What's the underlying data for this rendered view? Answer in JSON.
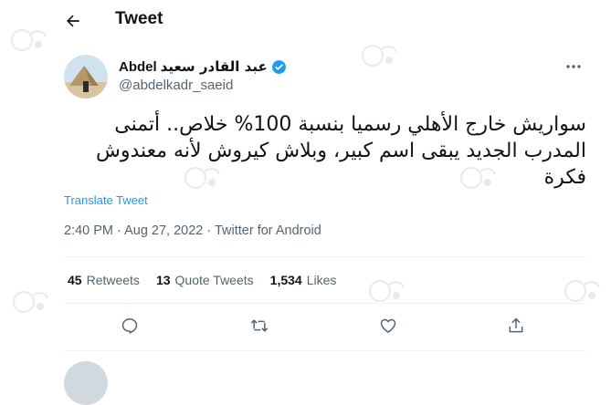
{
  "header": {
    "title": "Tweet"
  },
  "author": {
    "name_latin": "Abdel",
    "name_arabic": "عبد القادر سعيد",
    "handle": "@abdelkadr_saeid",
    "verified": true
  },
  "tweet": {
    "lines": [
      "سواريش خارج الأهلي رسميا بنسبة 100% خلاص.. أتمنى",
      "المدرب الجديد يبقى اسم كبير، وبلاش كيروش لأنه معندوش",
      "فكرة"
    ],
    "translate_label": "Translate Tweet",
    "meta": "2:40 PM · Aug 27, 2022 · Twitter for Android"
  },
  "stats": {
    "retweets": {
      "count": "45",
      "label": "Retweets"
    },
    "quotes": {
      "count": "13",
      "label": "Quote Tweets"
    },
    "likes": {
      "count": "1,534",
      "label": "Likes"
    }
  },
  "icons": {
    "back": "arrow-left-icon",
    "verified": "verified-badge-icon",
    "more": "more-icon",
    "reply": "reply-icon",
    "retweet": "retweet-icon",
    "like": "heart-icon",
    "share": "share-icon"
  },
  "colors": {
    "accent": "#1d9bf0",
    "text": "#0f1419",
    "secondary": "#536471",
    "divider": "#eff3f4"
  }
}
